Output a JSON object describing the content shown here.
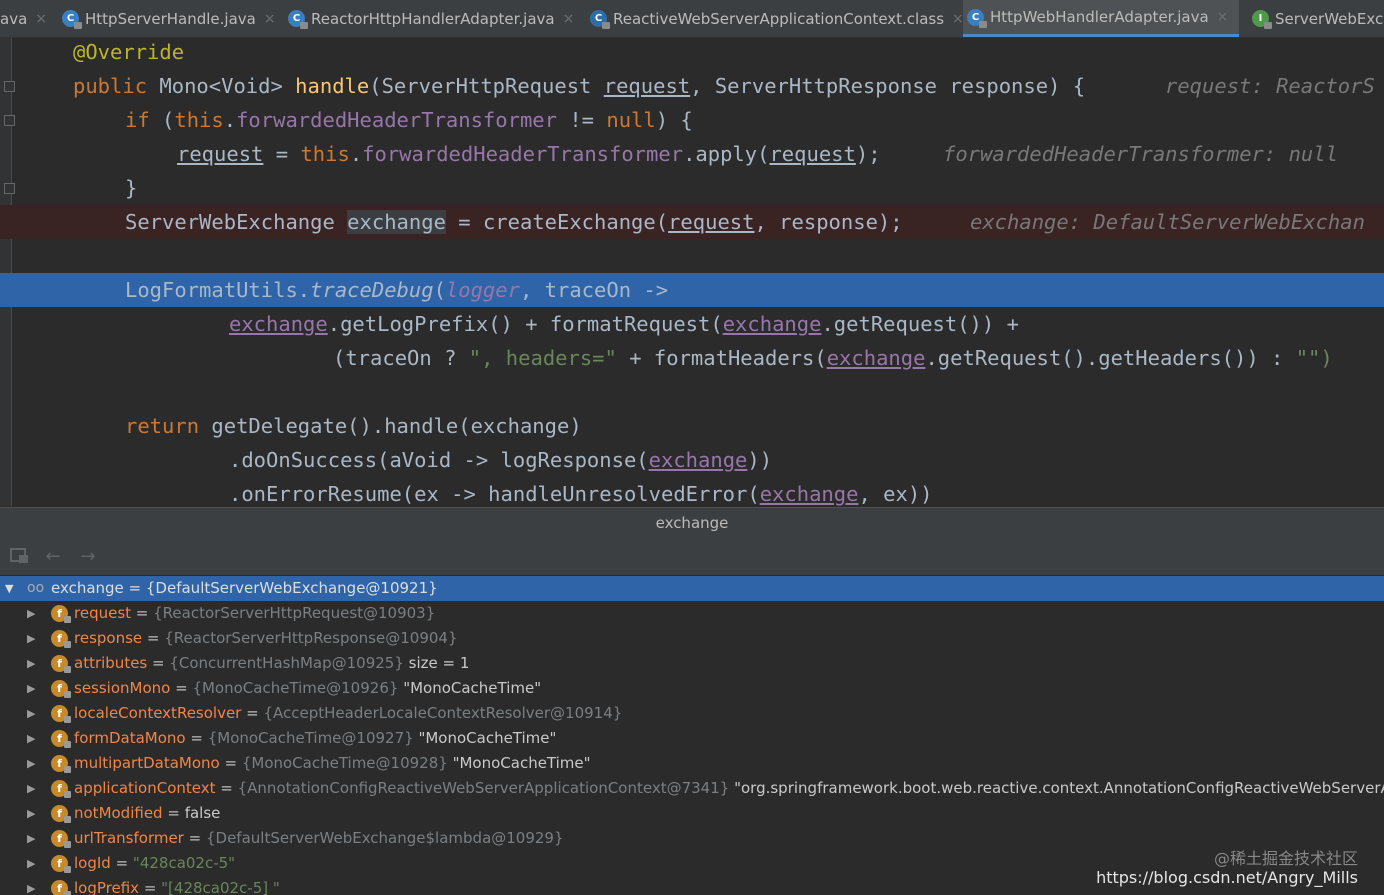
{
  "tabs": [
    {
      "label": "ava",
      "icon": "",
      "active": false
    },
    {
      "label": "HttpServerHandle.java",
      "icon": "java-class-icon",
      "active": false
    },
    {
      "label": "ReactorHttpHandlerAdapter.java",
      "icon": "java-class-icon",
      "active": false
    },
    {
      "label": "ReactiveWebServerApplicationContext.class",
      "icon": "class-file-icon",
      "active": false
    },
    {
      "label": "HttpWebHandlerAdapter.java",
      "icon": "java-class-icon",
      "active": true
    },
    {
      "label": "ServerWebExch",
      "icon": "java-interface-icon",
      "active": false
    }
  ],
  "tab_close_glyph": "×",
  "code": {
    "l1": "@Override",
    "l2": {
      "kw": "public",
      "t1": " Mono<Void> ",
      "fn": "handle",
      "t2": "(ServerHttpRequest ",
      "req": "request",
      "t3": ", ServerHttpResponse response) {",
      "hint": "request: ReactorS"
    },
    "l3": {
      "kw": "if",
      "t1": " (",
      "kw2": "this",
      "t2": ".",
      "fld": "forwardedHeaderTransformer",
      "t3": " != ",
      "kw3": "null",
      "t4": ") {"
    },
    "l4": {
      "req": "request",
      "t1": " = ",
      "kw": "this",
      "t2": ".",
      "fld": "forwardedHeaderTransformer",
      "t3": ".apply(",
      "req2": "request",
      "t4": ");",
      "hint": "forwardedHeaderTransformer: null"
    },
    "l5": "}",
    "l6": {
      "t1": "ServerWebExchange ",
      "var": "exchange",
      "t2": " = createExchange(",
      "req": "request",
      "t3": ", response);",
      "hint": "exchange: DefaultServerWebExchan"
    },
    "l7": {
      "t1": "LogFormatUtils.",
      "fn": "traceDebug",
      "t2": "(",
      "fld": "logger",
      "t3": ", traceOn ->"
    },
    "l8": {
      "ex": "exchange",
      "t1": ".getLogPrefix() + formatRequest(",
      "ex2": "exchange",
      "t2": ".getRequest()) +"
    },
    "l9": {
      "t1": "(traceOn ? ",
      "s1": "\", headers=\"",
      "t2": " + formatHeaders(",
      "ex": "exchange",
      "t3": ".getRequest().getHeaders()) : ",
      "s2": "\"\")"
    },
    "l10": {
      "kw": "return",
      "t1": " getDelegate().handle(exchange)"
    },
    "l11": {
      "t1": ".doOnSuccess(aVoid -> logResponse(",
      "ex": "exchange",
      "t2": "))"
    },
    "l12": {
      "t1": ".onErrorResume(ex -> handleUnresolvedError(",
      "ex": "exchange",
      "t2": ", ex))"
    }
  },
  "panel": {
    "title": "exchange",
    "root": {
      "name": "exchange",
      "value": "{DefaultServerWebExchange@10921}"
    },
    "fields": [
      {
        "name": "request",
        "type": "{ReactorServerHttpRequest@10903}",
        "extra": ""
      },
      {
        "name": "response",
        "type": "{ReactorServerHttpResponse@10904}",
        "extra": ""
      },
      {
        "name": "attributes",
        "type": "{ConcurrentHashMap@10925}",
        "extra": "size = 1"
      },
      {
        "name": "sessionMono",
        "type": "{MonoCacheTime@10926}",
        "extra": "\"MonoCacheTime\""
      },
      {
        "name": "localeContextResolver",
        "type": "{AcceptHeaderLocaleContextResolver@10914}",
        "extra": ""
      },
      {
        "name": "formDataMono",
        "type": "{MonoCacheTime@10927}",
        "extra": "\"MonoCacheTime\""
      },
      {
        "name": "multipartDataMono",
        "type": "{MonoCacheTime@10928}",
        "extra": "\"MonoCacheTime\""
      },
      {
        "name": "applicationContext",
        "type": "{AnnotationConfigReactiveWebServerApplicationContext@7341}",
        "extra": "\"org.springframework.boot.web.reactive.context.AnnotationConfigReactiveWebServerAppli"
      },
      {
        "name": "notModified",
        "type": "",
        "extra": "false"
      },
      {
        "name": "urlTransformer",
        "type": "{DefaultServerWebExchange$lambda@10929}",
        "extra": ""
      },
      {
        "name": "logId",
        "type": "",
        "extra": "\"428ca02c-5\""
      },
      {
        "name": "logPrefix",
        "type": "",
        "extra": "\"[428ca02c-5] \""
      }
    ]
  },
  "watermark": {
    "cn": "@稀土掘金技术社区",
    "url": "https://blog.csdn.net/Angry_Mills"
  },
  "colors": {
    "selection": "#2f65a8",
    "breakpoint_line": "#3a2323",
    "field_name": "#f08548",
    "field_icon": "#c78a2a"
  }
}
